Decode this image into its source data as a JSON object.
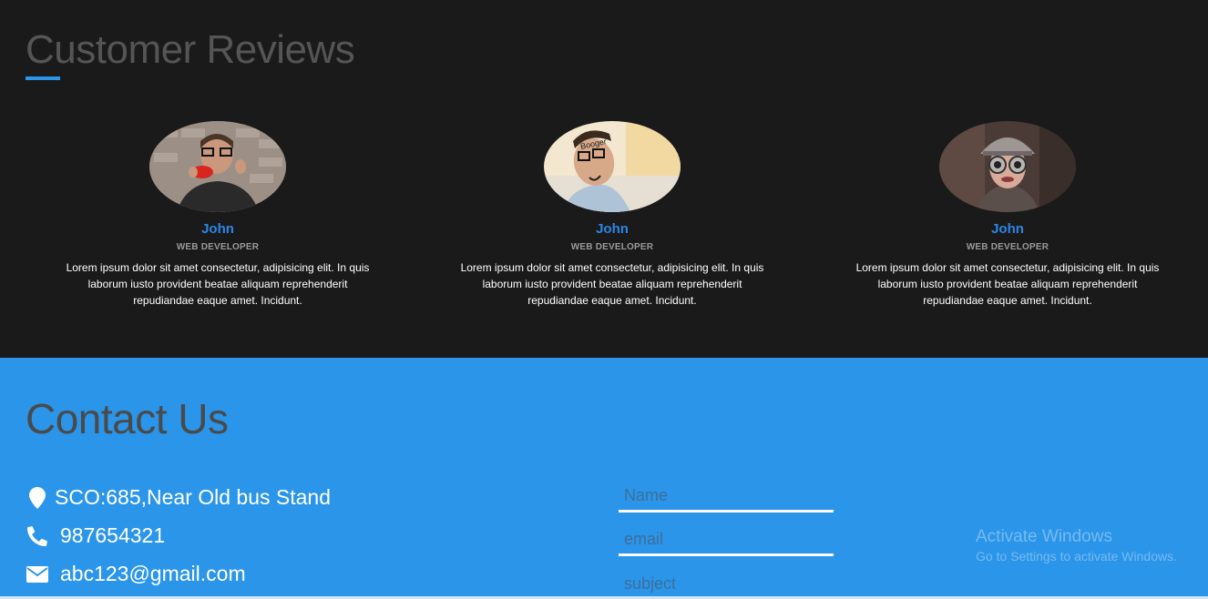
{
  "reviews": {
    "title": "Customer Reviews",
    "accent_color": "#2b95e9",
    "items": [
      {
        "name": "John",
        "role": "WEB DEVELOPER",
        "text": "Lorem ipsum dolor sit amet consectetur, adipisicing elit. In quis laborum iusto provident beatae aliquam reprehenderit repudiandae eaque amet. Incidunt."
      },
      {
        "name": "John",
        "role": "WEB DEVELOPER",
        "text": "Lorem ipsum dolor sit amet consectetur, adipisicing elit. In quis laborum iusto provident beatae aliquam reprehenderit repudiandae eaque amet. Incidunt."
      },
      {
        "name": "John",
        "role": "WEB DEVELOPER",
        "text": "Lorem ipsum dolor sit amet consectetur, adipisicing elit. In quis laborum iusto provident beatae aliquam reprehenderit repudiandae eaque amet. Incidunt."
      }
    ]
  },
  "contact": {
    "title": "Contact Us",
    "background_color": "#2b95e9",
    "address": {
      "icon": "map-marker-icon",
      "text": "SCO:685,Near Old bus Stand"
    },
    "phone": {
      "icon": "phone-icon",
      "text": "987654321"
    },
    "email": {
      "icon": "envelope-icon",
      "text": "abc123@gmail.com"
    },
    "form": {
      "name_placeholder": "Name",
      "email_placeholder": "email",
      "subject_placeholder": "subject"
    }
  },
  "watermark": {
    "title": "Activate Windows",
    "subtitle": "Go to Settings to activate Windows."
  }
}
